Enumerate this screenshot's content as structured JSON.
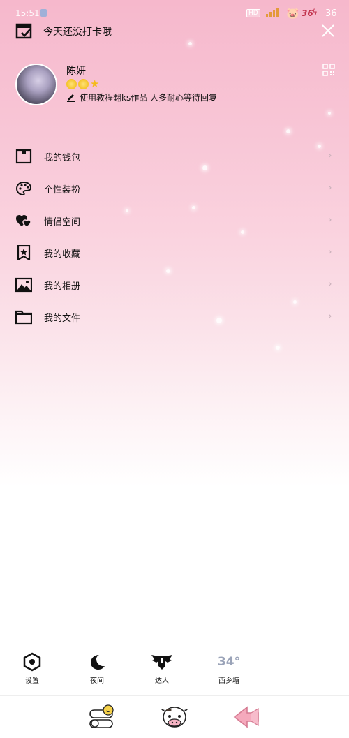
{
  "statusbar": {
    "time": "15:51",
    "hd": "HD",
    "carrier_temp": "36",
    "battery": "36"
  },
  "header": {
    "checkin_text": "今天还没打卡哦"
  },
  "profile": {
    "name": "陈妍",
    "signature": "使用教程翻ks作品 人多耐心等待回复"
  },
  "menu": [
    {
      "label": "我的钱包",
      "icon": "wallet-icon"
    },
    {
      "label": "个性装扮",
      "icon": "palette-icon"
    },
    {
      "label": "情侣空间",
      "icon": "couple-hearts-icon"
    },
    {
      "label": "我的收藏",
      "icon": "bookmark-star-icon"
    },
    {
      "label": "我的相册",
      "icon": "photo-album-icon"
    },
    {
      "label": "我的文件",
      "icon": "folder-icon"
    }
  ],
  "quick": [
    {
      "label": "设置",
      "icon": "settings-icon"
    },
    {
      "label": "夜间",
      "icon": "moon-icon"
    },
    {
      "label": "达人",
      "icon": "winged-badge-icon"
    },
    {
      "label": "西乡塘",
      "value": "34°",
      "icon": "weather-icon"
    }
  ],
  "colors": {
    "accent_pink": "#f6b8cc",
    "chevron": "#c9b0ba"
  }
}
